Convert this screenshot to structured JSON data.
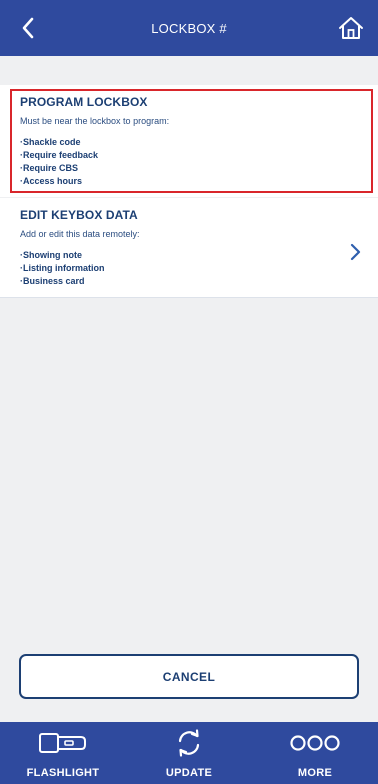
{
  "header": {
    "title": "LOCKBOX #",
    "back_icon": "chevron-left-icon",
    "home_icon": "home-icon"
  },
  "program_card": {
    "title": "PROGRAM LOCKBOX",
    "subtitle": "Must be near the lockbox to program:",
    "items": [
      "Shackle code",
      "Require feedback",
      "Require  CBS",
      "Access hours"
    ],
    "highlight_color": "#d9262b"
  },
  "edit_card": {
    "title": "EDIT KEYBOX DATA",
    "subtitle": "Add or edit this data remotely:",
    "items": [
      "Showing note",
      "Listing information",
      "Business card"
    ],
    "chevron_icon": "chevron-right-icon"
  },
  "cancel_button": {
    "label": "CANCEL"
  },
  "bottom_nav": [
    {
      "label": "FLASHLIGHT",
      "icon": "flashlight-icon"
    },
    {
      "label": "UPDATE",
      "icon": "refresh-icon"
    },
    {
      "label": "MORE",
      "icon": "more-icon"
    }
  ],
  "colors": {
    "brand": "#2f4a9e",
    "text": "#1c3f73",
    "background": "#eff0f2"
  }
}
